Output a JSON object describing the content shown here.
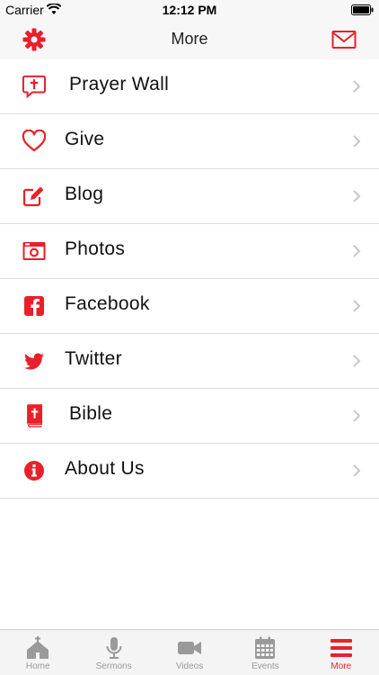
{
  "status_bar": {
    "carrier": "Carrier",
    "time": "12:12 PM"
  },
  "nav": {
    "title": "More",
    "left_icon": "gear-icon",
    "right_icon": "envelope-icon"
  },
  "menu": {
    "items": [
      {
        "label": "Prayer Wall",
        "icon": "prayer-bubble-icon"
      },
      {
        "label": "Give",
        "icon": "heart-icon"
      },
      {
        "label": "Blog",
        "icon": "edit-icon"
      },
      {
        "label": "Photos",
        "icon": "camera-icon"
      },
      {
        "label": "Facebook",
        "icon": "facebook-icon"
      },
      {
        "label": "Twitter",
        "icon": "twitter-icon"
      },
      {
        "label": "Bible",
        "icon": "bible-icon"
      },
      {
        "label": "About Us",
        "icon": "info-icon"
      }
    ]
  },
  "tab_bar": {
    "tabs": [
      {
        "label": "Home",
        "icon": "church-icon",
        "active": false
      },
      {
        "label": "Sermons",
        "icon": "microphone-icon",
        "active": false
      },
      {
        "label": "Videos",
        "icon": "video-camera-icon",
        "active": false
      },
      {
        "label": "Events",
        "icon": "calendar-icon",
        "active": false
      },
      {
        "label": "More",
        "icon": "menu-icon",
        "active": true
      }
    ]
  },
  "colors": {
    "accent": "#e8202a",
    "inactive": "#9a9a9a",
    "bar_background": "#f7f7f7",
    "separator": "#dddddd"
  }
}
